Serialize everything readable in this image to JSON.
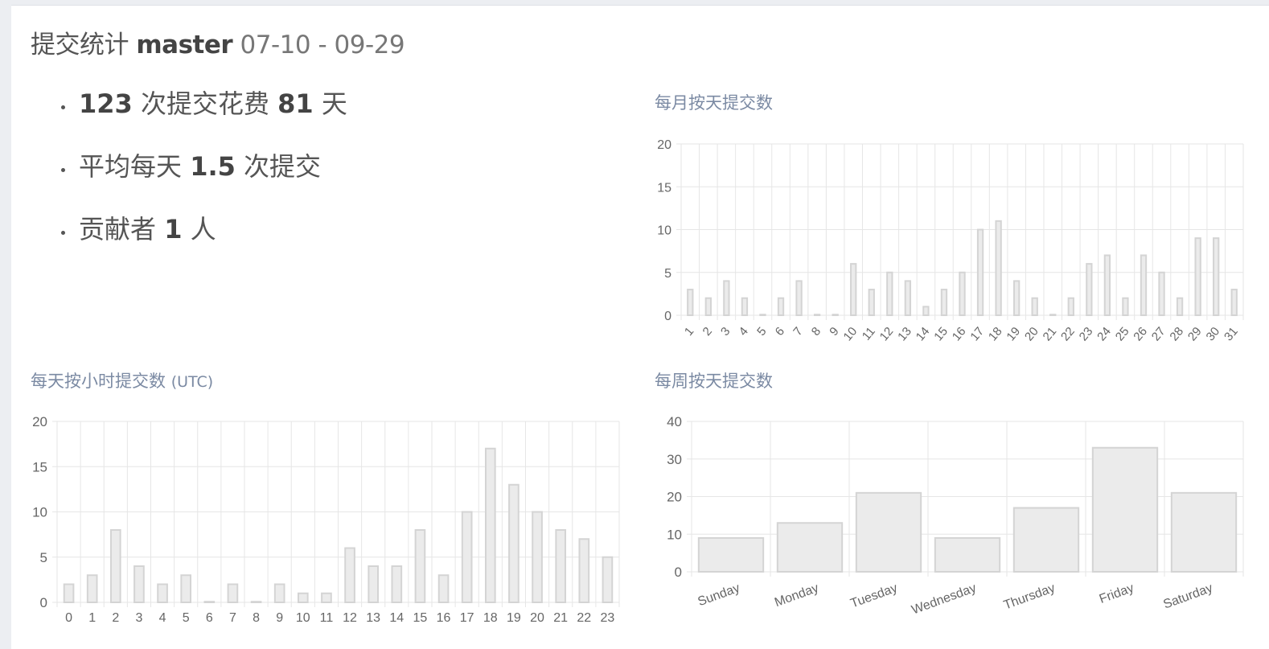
{
  "header": {
    "label": "提交统计",
    "branch": "master",
    "range": "07-10 - 09-29"
  },
  "stats": [
    {
      "prefix": "",
      "value": "123",
      "mid": " 次提交花费 ",
      "value2": "81",
      "suffix": " 天"
    },
    {
      "prefix": "平均每天 ",
      "value": "1.5",
      "mid": " 次提交",
      "value2": "",
      "suffix": ""
    },
    {
      "prefix": "贡献者 ",
      "value": "1",
      "mid": " 人",
      "value2": "",
      "suffix": ""
    }
  ],
  "chart_titles": {
    "month": "每月按天提交数",
    "hour": "每天按小时提交数",
    "hour_suffix": "(UTC)",
    "week": "每周按天提交数"
  },
  "colors": {
    "bar_fill": "#ebebeb",
    "bar_stroke": "#d4d4d4",
    "grid": "#e6e6e6",
    "title": "#7b8aa3"
  },
  "chart_data": [
    {
      "id": "month",
      "type": "bar",
      "categories": [
        "1",
        "2",
        "3",
        "4",
        "5",
        "6",
        "7",
        "8",
        "9",
        "10",
        "11",
        "12",
        "13",
        "14",
        "15",
        "16",
        "17",
        "18",
        "19",
        "20",
        "21",
        "22",
        "23",
        "24",
        "25",
        "26",
        "27",
        "28",
        "29",
        "30",
        "31"
      ],
      "values": [
        3,
        2,
        4,
        2,
        0,
        2,
        4,
        0,
        0,
        6,
        3,
        5,
        4,
        1,
        3,
        5,
        10,
        11,
        4,
        2,
        0,
        2,
        6,
        7,
        2,
        7,
        5,
        2,
        9,
        9,
        3
      ],
      "ylim": [
        0,
        20
      ],
      "yticks": [
        0,
        5,
        10,
        15,
        20
      ],
      "xtick_rotation": "diagonal",
      "grid": true
    },
    {
      "id": "hour",
      "type": "bar",
      "categories": [
        "0",
        "1",
        "2",
        "3",
        "4",
        "5",
        "6",
        "7",
        "8",
        "9",
        "10",
        "11",
        "12",
        "13",
        "14",
        "15",
        "16",
        "17",
        "18",
        "19",
        "20",
        "21",
        "22",
        "23"
      ],
      "values": [
        2,
        3,
        8,
        4,
        2,
        3,
        0,
        2,
        0,
        2,
        1,
        1,
        6,
        4,
        4,
        8,
        3,
        10,
        17,
        13,
        10,
        8,
        7,
        5
      ],
      "ylim": [
        0,
        20
      ],
      "yticks": [
        0,
        5,
        10,
        15,
        20
      ],
      "xtick_rotation": "none",
      "grid": true
    },
    {
      "id": "week",
      "type": "bar",
      "categories": [
        "Sunday",
        "Monday",
        "Tuesday",
        "Wednesday",
        "Thursday",
        "Friday",
        "Saturday"
      ],
      "values": [
        9,
        13,
        21,
        9,
        17,
        33,
        21
      ],
      "ylim": [
        0,
        40
      ],
      "yticks": [
        0,
        10,
        20,
        30,
        40
      ],
      "xtick_rotation": "slight",
      "grid": true
    }
  ]
}
